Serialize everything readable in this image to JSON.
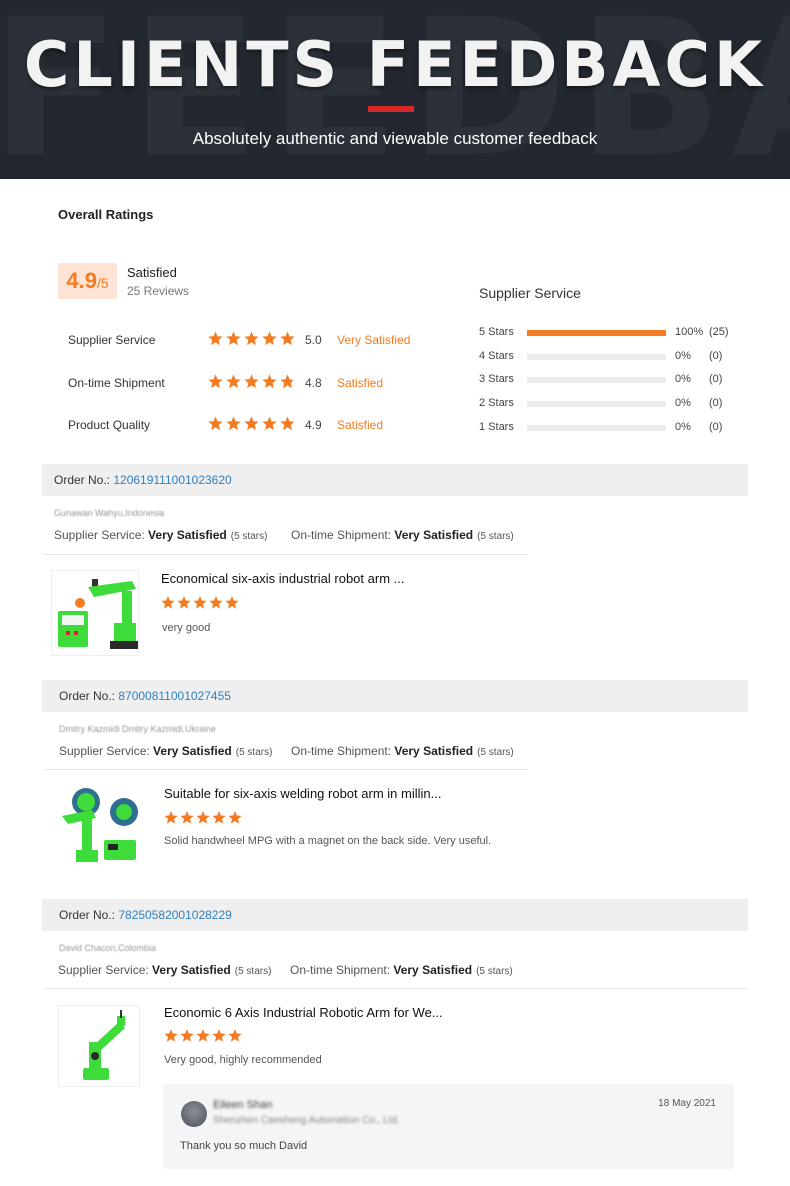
{
  "hero": {
    "watermark": "FEEDBACK",
    "title": "CLIENTS FEEDBACK",
    "subtitle": "Absolutely authentic and viewable customer feedback"
  },
  "overall": {
    "heading": "Overall Ratings",
    "score": "4.9",
    "score_suffix": "/5",
    "score_label": "Satisfied",
    "reviews": "25 Reviews",
    "categories": [
      {
        "label": "Supplier Service",
        "value": "5.0",
        "stars": 5.0,
        "satisfaction": "Very Satisfied"
      },
      {
        "label": "On-time Shipment",
        "value": "4.8",
        "stars": 4.8,
        "satisfaction": "Satisfied"
      },
      {
        "label": "Product Quality",
        "value": "4.9",
        "stars": 4.9,
        "satisfaction": "Satisfied"
      }
    ]
  },
  "distribution": {
    "heading": "Supplier Service",
    "rows": [
      {
        "label": "5  Stars",
        "pct": "100%",
        "count": "(25)",
        "fraction": 1.0
      },
      {
        "label": "4  Stars",
        "pct": "0%",
        "count": "(0)",
        "fraction": 0
      },
      {
        "label": "3  Stars",
        "pct": "0%",
        "count": "(0)",
        "fraction": 0
      },
      {
        "label": "2  Stars",
        "pct": "0%",
        "count": "(0)",
        "fraction": 0
      },
      {
        "label": "1  Stars",
        "pct": "0%",
        "count": "(0)",
        "fraction": 0
      }
    ]
  },
  "orders": [
    {
      "order_label": "Order No.: ",
      "order_no": "120619111001023620",
      "buyer": "Gunawan Wahyu,Indonesia",
      "supplier_service_label": "Supplier Service: ",
      "supplier_service_value": "Very Satisfied",
      "supplier_service_stars": "(5 stars)",
      "shipment_label": "On-time Shipment: ",
      "shipment_value": "Very Satisfied",
      "shipment_stars": "(5 stars)",
      "product_title": "Economical six-axis industrial robot arm ...",
      "rating": 5,
      "comment": "very good"
    },
    {
      "order_label": "Order No.: ",
      "order_no": "87000811001027455",
      "buyer": "Dmitry Kazmidi Dmitry Kazmidi,Ukraine",
      "supplier_service_label": "Supplier Service: ",
      "supplier_service_value": "Very Satisfied",
      "supplier_service_stars": "(5 stars)",
      "shipment_label": "On-time Shipment: ",
      "shipment_value": "Very Satisfied",
      "shipment_stars": "(5 stars)",
      "product_title": "Suitable for six-axis welding robot arm in millin...",
      "rating": 5,
      "comment": "Solid handwheel MPG with a magnet on the back side. Very useful."
    },
    {
      "order_label": "Order No.: ",
      "order_no": "78250582001028229",
      "buyer": "David Chacon,Colombia",
      "supplier_service_label": "Supplier Service: ",
      "supplier_service_value": "Very Satisfied",
      "supplier_service_stars": "(5 stars)",
      "shipment_label": "On-time Shipment: ",
      "shipment_value": "Very Satisfied",
      "shipment_stars": "(5 stars)",
      "product_title": "Economic 6 Axis Industrial Robotic Arm for We...",
      "rating": 5,
      "comment": "Very good, highly recommended"
    }
  ],
  "reply": {
    "name": "Eileen Shan",
    "company": "Shenzhen Caesheng Automation Co., Ltd.",
    "date": "18 May 2021",
    "text": "Thank you so much David"
  },
  "colors": {
    "accent": "#f37b21",
    "accent_light": "#fde4d4",
    "link": "#2f7fc1",
    "hero_bg": "#23272f",
    "hero_rule": "#d62828",
    "product_green": "#3ddc3b"
  }
}
